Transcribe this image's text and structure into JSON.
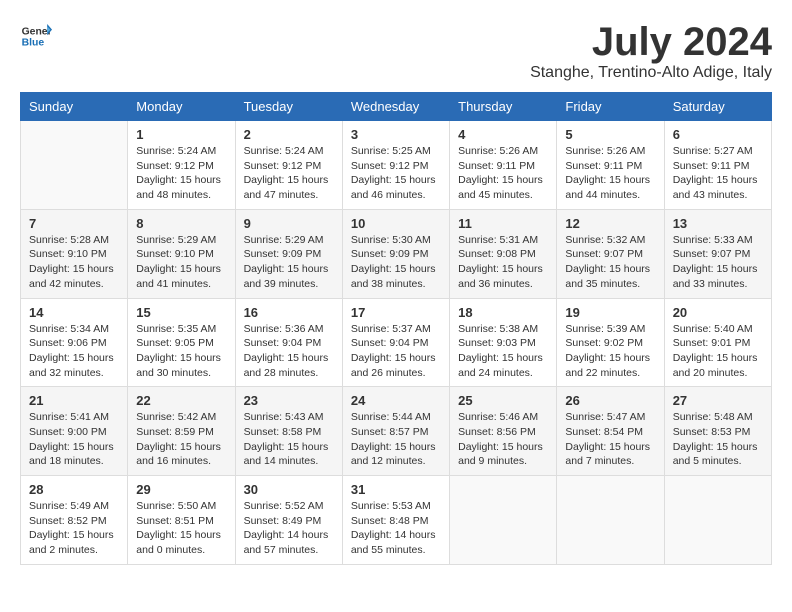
{
  "header": {
    "logo_line1": "General",
    "logo_line2": "Blue",
    "month": "July 2024",
    "location": "Stanghe, Trentino-Alto Adige, Italy"
  },
  "days_of_week": [
    "Sunday",
    "Monday",
    "Tuesday",
    "Wednesday",
    "Thursday",
    "Friday",
    "Saturday"
  ],
  "weeks": [
    [
      {
        "day": "",
        "info": ""
      },
      {
        "day": "1",
        "info": "Sunrise: 5:24 AM\nSunset: 9:12 PM\nDaylight: 15 hours\nand 48 minutes."
      },
      {
        "day": "2",
        "info": "Sunrise: 5:24 AM\nSunset: 9:12 PM\nDaylight: 15 hours\nand 47 minutes."
      },
      {
        "day": "3",
        "info": "Sunrise: 5:25 AM\nSunset: 9:12 PM\nDaylight: 15 hours\nand 46 minutes."
      },
      {
        "day": "4",
        "info": "Sunrise: 5:26 AM\nSunset: 9:11 PM\nDaylight: 15 hours\nand 45 minutes."
      },
      {
        "day": "5",
        "info": "Sunrise: 5:26 AM\nSunset: 9:11 PM\nDaylight: 15 hours\nand 44 minutes."
      },
      {
        "day": "6",
        "info": "Sunrise: 5:27 AM\nSunset: 9:11 PM\nDaylight: 15 hours\nand 43 minutes."
      }
    ],
    [
      {
        "day": "7",
        "info": "Sunrise: 5:28 AM\nSunset: 9:10 PM\nDaylight: 15 hours\nand 42 minutes."
      },
      {
        "day": "8",
        "info": "Sunrise: 5:29 AM\nSunset: 9:10 PM\nDaylight: 15 hours\nand 41 minutes."
      },
      {
        "day": "9",
        "info": "Sunrise: 5:29 AM\nSunset: 9:09 PM\nDaylight: 15 hours\nand 39 minutes."
      },
      {
        "day": "10",
        "info": "Sunrise: 5:30 AM\nSunset: 9:09 PM\nDaylight: 15 hours\nand 38 minutes."
      },
      {
        "day": "11",
        "info": "Sunrise: 5:31 AM\nSunset: 9:08 PM\nDaylight: 15 hours\nand 36 minutes."
      },
      {
        "day": "12",
        "info": "Sunrise: 5:32 AM\nSunset: 9:07 PM\nDaylight: 15 hours\nand 35 minutes."
      },
      {
        "day": "13",
        "info": "Sunrise: 5:33 AM\nSunset: 9:07 PM\nDaylight: 15 hours\nand 33 minutes."
      }
    ],
    [
      {
        "day": "14",
        "info": "Sunrise: 5:34 AM\nSunset: 9:06 PM\nDaylight: 15 hours\nand 32 minutes."
      },
      {
        "day": "15",
        "info": "Sunrise: 5:35 AM\nSunset: 9:05 PM\nDaylight: 15 hours\nand 30 minutes."
      },
      {
        "day": "16",
        "info": "Sunrise: 5:36 AM\nSunset: 9:04 PM\nDaylight: 15 hours\nand 28 minutes."
      },
      {
        "day": "17",
        "info": "Sunrise: 5:37 AM\nSunset: 9:04 PM\nDaylight: 15 hours\nand 26 minutes."
      },
      {
        "day": "18",
        "info": "Sunrise: 5:38 AM\nSunset: 9:03 PM\nDaylight: 15 hours\nand 24 minutes."
      },
      {
        "day": "19",
        "info": "Sunrise: 5:39 AM\nSunset: 9:02 PM\nDaylight: 15 hours\nand 22 minutes."
      },
      {
        "day": "20",
        "info": "Sunrise: 5:40 AM\nSunset: 9:01 PM\nDaylight: 15 hours\nand 20 minutes."
      }
    ],
    [
      {
        "day": "21",
        "info": "Sunrise: 5:41 AM\nSunset: 9:00 PM\nDaylight: 15 hours\nand 18 minutes."
      },
      {
        "day": "22",
        "info": "Sunrise: 5:42 AM\nSunset: 8:59 PM\nDaylight: 15 hours\nand 16 minutes."
      },
      {
        "day": "23",
        "info": "Sunrise: 5:43 AM\nSunset: 8:58 PM\nDaylight: 15 hours\nand 14 minutes."
      },
      {
        "day": "24",
        "info": "Sunrise: 5:44 AM\nSunset: 8:57 PM\nDaylight: 15 hours\nand 12 minutes."
      },
      {
        "day": "25",
        "info": "Sunrise: 5:46 AM\nSunset: 8:56 PM\nDaylight: 15 hours\nand 9 minutes."
      },
      {
        "day": "26",
        "info": "Sunrise: 5:47 AM\nSunset: 8:54 PM\nDaylight: 15 hours\nand 7 minutes."
      },
      {
        "day": "27",
        "info": "Sunrise: 5:48 AM\nSunset: 8:53 PM\nDaylight: 15 hours\nand 5 minutes."
      }
    ],
    [
      {
        "day": "28",
        "info": "Sunrise: 5:49 AM\nSunset: 8:52 PM\nDaylight: 15 hours\nand 2 minutes."
      },
      {
        "day": "29",
        "info": "Sunrise: 5:50 AM\nSunset: 8:51 PM\nDaylight: 15 hours\nand 0 minutes."
      },
      {
        "day": "30",
        "info": "Sunrise: 5:52 AM\nSunset: 8:49 PM\nDaylight: 14 hours\nand 57 minutes."
      },
      {
        "day": "31",
        "info": "Sunrise: 5:53 AM\nSunset: 8:48 PM\nDaylight: 14 hours\nand 55 minutes."
      },
      {
        "day": "",
        "info": ""
      },
      {
        "day": "",
        "info": ""
      },
      {
        "day": "",
        "info": ""
      }
    ]
  ]
}
